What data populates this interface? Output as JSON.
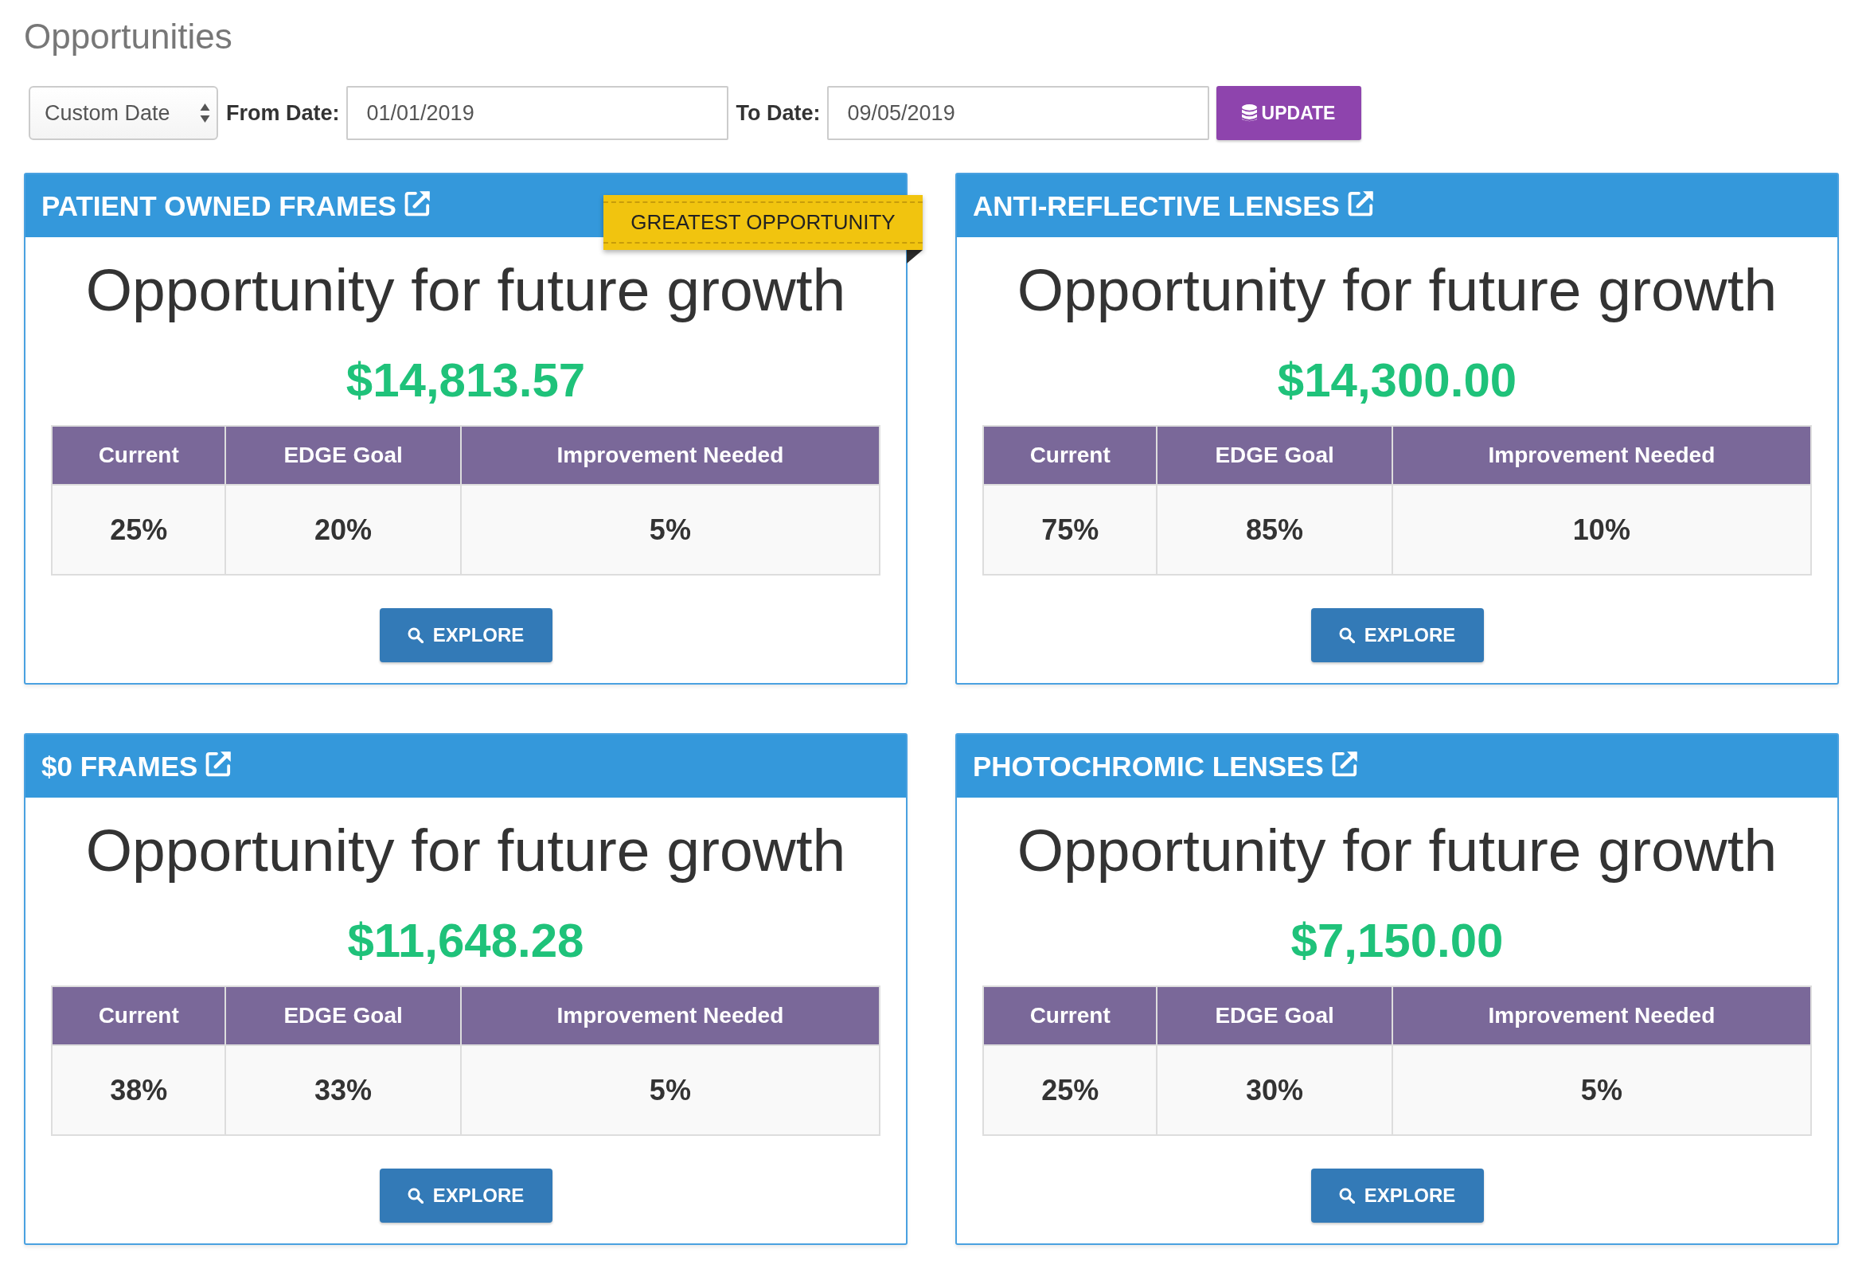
{
  "page_title": "Opportunities",
  "filters": {
    "range": {
      "value": "Custom Date"
    },
    "from_label": "From Date:",
    "from_date": {
      "value": "01/01/2019"
    },
    "to_label": "To Date:",
    "to_date": {
      "value": "09/05/2019"
    },
    "update_button": "UPDATE"
  },
  "cards": [
    {
      "title": "PATIENT OWNED FRAMES",
      "ribbon": "GREATEST OPPORTUNITY",
      "headline": "Opportunity for future growth",
      "amount": "$14,813.57",
      "table": {
        "columns": [
          "Current",
          "EDGE Goal",
          "Improvement Needed"
        ],
        "rows": [
          [
            "25%",
            "20%",
            "5%"
          ]
        ]
      },
      "button": "EXPLORE"
    },
    {
      "title": "ANTI-REFLECTIVE LENSES",
      "headline": "Opportunity for future growth",
      "amount": "$14,300.00",
      "table": {
        "columns": [
          "Current",
          "EDGE Goal",
          "Improvement Needed"
        ],
        "rows": [
          [
            "75%",
            "85%",
            "10%"
          ]
        ]
      },
      "button": "EXPLORE"
    },
    {
      "title": "$0 FRAMES",
      "headline": "Opportunity for future growth",
      "amount": "$11,648.28",
      "table": {
        "columns": [
          "Current",
          "EDGE Goal",
          "Improvement Needed"
        ],
        "rows": [
          [
            "38%",
            "33%",
            "5%"
          ]
        ]
      },
      "button": "EXPLORE"
    },
    {
      "title": "PHOTOCHROMIC LENSES",
      "headline": "Opportunity for future growth",
      "amount": "$7,150.00",
      "table": {
        "columns": [
          "Current",
          "EDGE Goal",
          "Improvement Needed"
        ],
        "rows": [
          [
            "25%",
            "30%",
            "5%"
          ]
        ]
      },
      "button": "EXPLORE"
    }
  ]
}
